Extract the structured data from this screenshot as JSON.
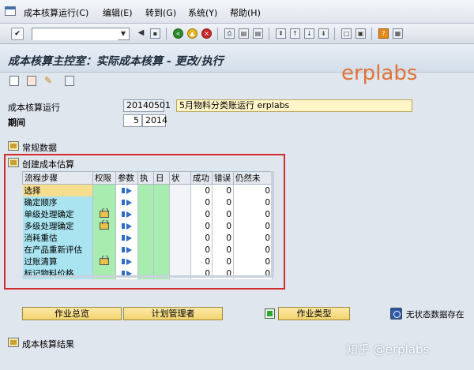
{
  "menu": {
    "items": [
      {
        "label": "成本核算运行(C)"
      },
      {
        "label": "编辑(E)"
      },
      {
        "label": "转到(G)"
      },
      {
        "label": "系统(Y)"
      },
      {
        "label": "帮助(H)"
      }
    ]
  },
  "toolbar": {
    "command_value": ""
  },
  "header": {
    "title": "成本核算主控室：实际成本核算 - 更改/执行",
    "watermark": "erplabs"
  },
  "fields": {
    "run_label": "成本核算运行",
    "run_date": "20140501",
    "run_description": "5月物料分类账运行 erplabs",
    "period_label": "期间",
    "period_month": "5",
    "period_year": "2014"
  },
  "sections": {
    "general": "常规数据",
    "create_estimate": "创建成本估算",
    "results": "成本核算结果"
  },
  "steps_table": {
    "columns": [
      "流程步骤",
      "权限",
      "参数",
      "执",
      "日",
      "状",
      "成功",
      "错误",
      "仍然未"
    ],
    "rows": [
      {
        "name": "选择",
        "lock": false,
        "success": "0",
        "error": "0",
        "pending": "0"
      },
      {
        "name": "确定顺序",
        "lock": false,
        "success": "0",
        "error": "0",
        "pending": "0"
      },
      {
        "name": "单级处理确定",
        "lock": true,
        "success": "0",
        "error": "0",
        "pending": "0"
      },
      {
        "name": "多级处理确定",
        "lock": true,
        "success": "0",
        "error": "0",
        "pending": "0"
      },
      {
        "name": "消耗重估",
        "lock": false,
        "success": "0",
        "error": "0",
        "pending": "0"
      },
      {
        "name": "在产品重新评估",
        "lock": false,
        "success": "0",
        "error": "0",
        "pending": "0"
      },
      {
        "name": "过账清算",
        "lock": true,
        "success": "0",
        "error": "0",
        "pending": "0"
      },
      {
        "name": "标记物料价格",
        "lock": false,
        "success": "0",
        "error": "0",
        "pending": "0"
      }
    ]
  },
  "buttons": {
    "job_overview": "作业总览",
    "plan_manager": "计划管理者",
    "job_type": "作业类型"
  },
  "status": {
    "no_status_data": "无状态数据存在"
  },
  "watermark_bottom": "知乎 @erplabs",
  "colors": {
    "highlight_frame": "#d12c2c",
    "button_yellow": "#f3d36e",
    "step_cyan": "#a9e4f0",
    "step_selected": "#f7dd8e",
    "check_green": "#a9ecb0"
  }
}
